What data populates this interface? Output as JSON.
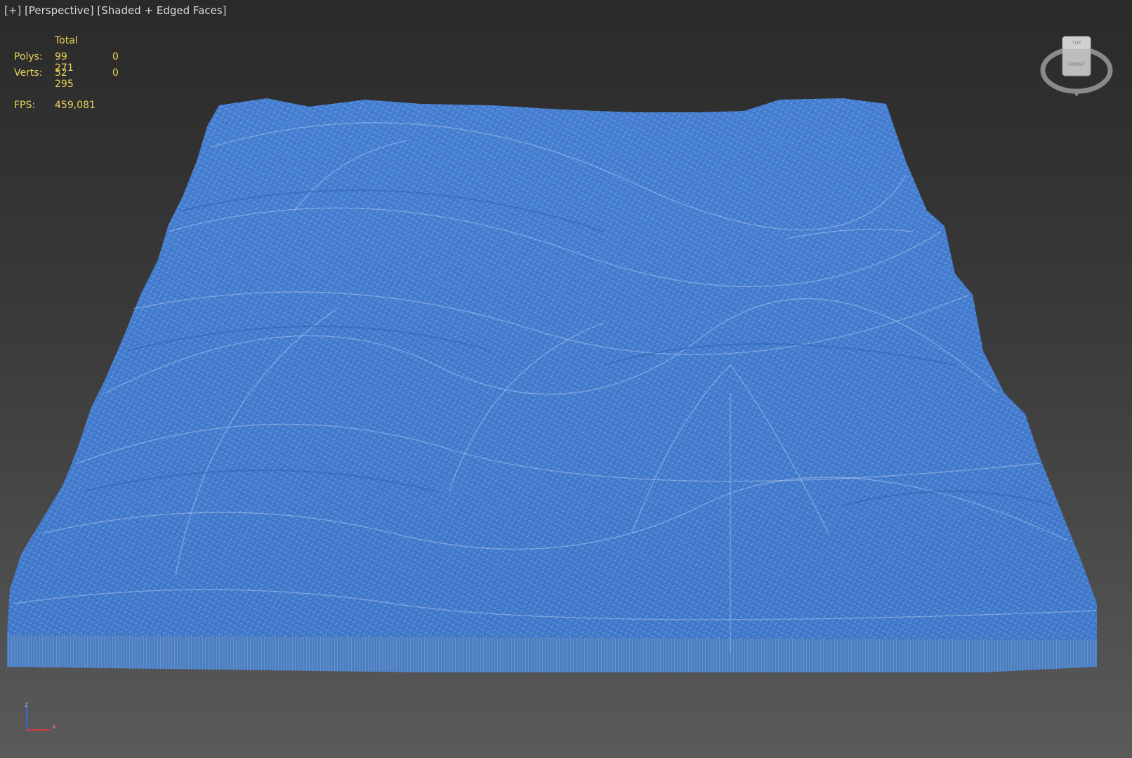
{
  "viewport": {
    "label_plus": "[+]",
    "label_view": "[Perspective]",
    "label_shading": "[Shaded + Edged Faces]"
  },
  "stats": {
    "header": "Total",
    "polys_label": "Polys:",
    "polys_total": "99 271",
    "polys_selected": "0",
    "verts_label": "Verts:",
    "verts_total": "52 295",
    "verts_selected": "0",
    "fps_label": "FPS:",
    "fps_value": "459,081"
  },
  "viewcube": {
    "top_label": "TOP",
    "front_label": "FRONT"
  },
  "axis": {
    "z_label": "z",
    "x_label": "x"
  },
  "colors": {
    "mesh_blue": "#3d78cc",
    "wire_light": "#c8d8f0",
    "stats_text": "#e8d25a",
    "label_text": "#d8d8d8"
  }
}
